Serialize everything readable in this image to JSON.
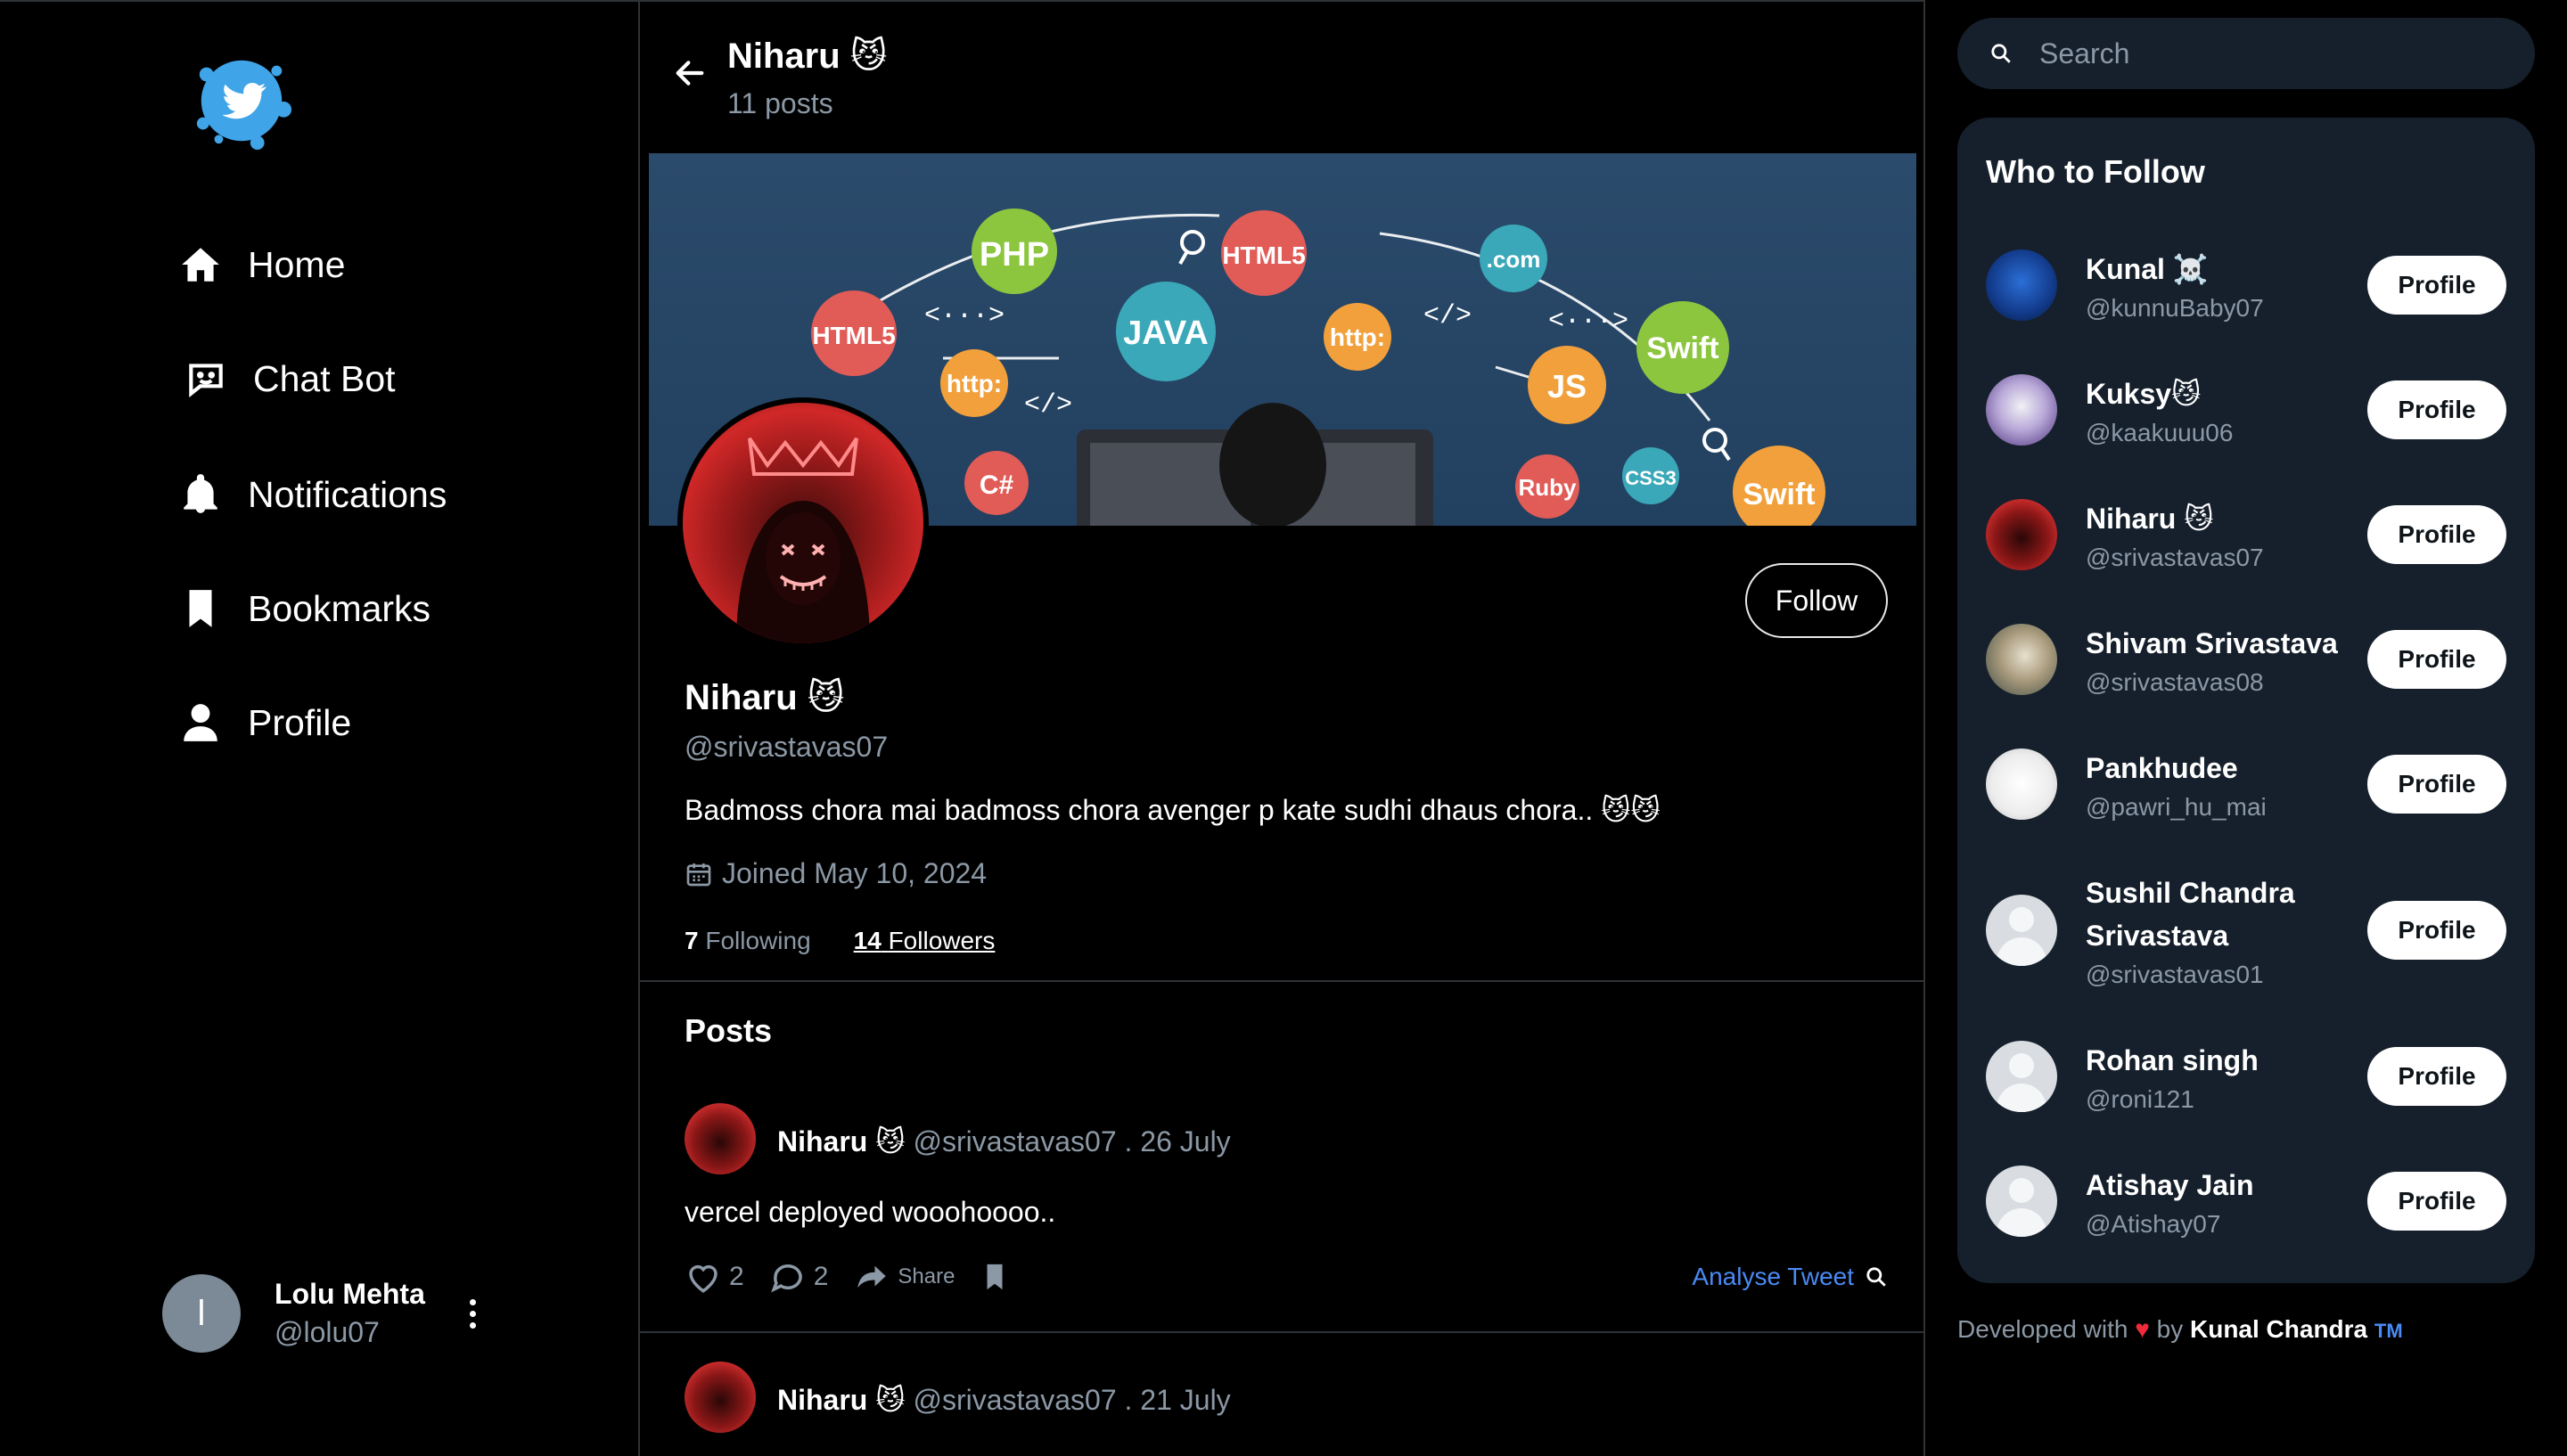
{
  "nav": {
    "items": [
      {
        "label": "Home",
        "icon": "home-icon"
      },
      {
        "label": "Chat Bot",
        "icon": "chatbot-icon"
      },
      {
        "label": "Notifications",
        "icon": "bell-icon"
      },
      {
        "label": "Bookmarks",
        "icon": "bookmark-icon"
      },
      {
        "label": "Profile",
        "icon": "person-icon"
      }
    ]
  },
  "current_user": {
    "initial": "l",
    "name": "Lolu Mehta",
    "handle": "@lolu07"
  },
  "header": {
    "name": "Niharu 😼",
    "posts_count": "11 posts"
  },
  "banner": {
    "badges": [
      "PHP",
      "HTML5",
      "HTML5",
      "JAVA",
      "http:",
      "http:",
      ".com",
      "Swift",
      "JS",
      "C#",
      "Ruby",
      "CSS3",
      "Swift"
    ],
    "glyphs": [
      "<···>",
      "</>",
      "</>",
      "<···>"
    ]
  },
  "profile": {
    "name": "Niharu 😼",
    "handle": "@srivastavas07",
    "bio": "Badmoss chora mai badmoss chora avenger p kate sudhi dhaus chora.. 😼😼",
    "joined": "Joined May 10, 2024",
    "following_count": "7",
    "following_label": "Following",
    "followers_count": "14",
    "followers_label": "Followers",
    "follow_button": "Follow"
  },
  "posts_section": {
    "title": "Posts"
  },
  "posts": [
    {
      "name": "Niharu 😼",
      "handle_date": "@srivastavas07 . 26 July",
      "text": "vercel deployed wooohoooo..",
      "likes": "2",
      "comments": "2",
      "share_label": "Share",
      "analyse_label": "Analyse Tweet"
    },
    {
      "name": "Niharu 😼",
      "handle_date": "@srivastavas07 . 21 July"
    }
  ],
  "search": {
    "placeholder": "Search"
  },
  "who_to_follow": {
    "title": "Who to Follow",
    "button_label": "Profile",
    "users": [
      {
        "name": "Kunal ☠️",
        "handle": "@kunnuBaby07",
        "avatar": "blue"
      },
      {
        "name": "Kuksy😼",
        "handle": "@kaakuuu06",
        "avatar": "purple"
      },
      {
        "name": "Niharu 😼",
        "handle": "@srivastavas07",
        "avatar": "red"
      },
      {
        "name": "Shivam Srivastava",
        "handle": "@srivastavas08",
        "avatar": "cartoon"
      },
      {
        "name": "Pankhudee",
        "handle": "@pawri_hu_mai",
        "avatar": "sketch"
      },
      {
        "name": "Sushil Chandra Srivastava",
        "handle": "@srivastavas01",
        "avatar": "default"
      },
      {
        "name": "Rohan singh",
        "handle": "@roni121",
        "avatar": "default"
      },
      {
        "name": "Atishay Jain",
        "handle": "@Atishay07",
        "avatar": "default"
      }
    ]
  },
  "footer": {
    "prefix": "Developed with",
    "by": "by",
    "author": "Kunal Chandra",
    "tm": "TM"
  },
  "colors": {
    "accent": "#4a8af4",
    "card_bg": "#16202c",
    "heart": "#f02a3a",
    "border": "#2f3336"
  }
}
